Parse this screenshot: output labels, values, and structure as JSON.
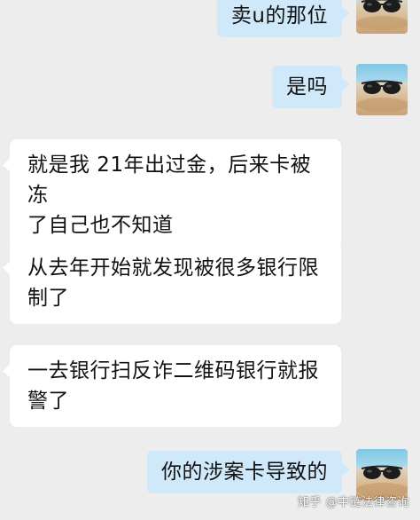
{
  "messages": [
    {
      "side": "out",
      "text": "卖u的那位"
    },
    {
      "side": "out",
      "text": "是吗"
    },
    {
      "side": "in",
      "lines": [
        "就是我 21年出过金，后来卡被冻",
        "了自己也不知道"
      ]
    },
    {
      "side": "in",
      "lines": [
        "从去年开始就发现被很多银行限",
        "制了"
      ]
    },
    {
      "side": "in",
      "lines": [
        "一去银行扫反诈二维码银行就报",
        "警了"
      ]
    },
    {
      "side": "out",
      "text": "你的涉案卡导致的"
    }
  ],
  "avatar": {
    "icon": "sunglasses-beach-avatar"
  },
  "watermark": "知乎 @中链法律咨询",
  "colors": {
    "background": "#ededed",
    "outgoing_bubble": "#cfe9fb",
    "incoming_bubble": "#ffffff"
  }
}
